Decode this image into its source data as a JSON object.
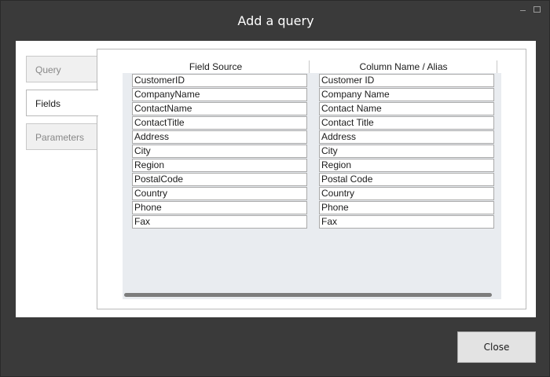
{
  "window": {
    "title": "Add a query"
  },
  "tabs": [
    {
      "label": "Query",
      "active": false
    },
    {
      "label": "Fields",
      "active": true
    },
    {
      "label": "Parameters",
      "active": false
    }
  ],
  "grid": {
    "columns": [
      "Field Source",
      "Column Name / Alias"
    ],
    "rows": [
      {
        "source": "CustomerID",
        "alias": "Customer ID"
      },
      {
        "source": "CompanyName",
        "alias": "Company Name"
      },
      {
        "source": "ContactName",
        "alias": "Contact Name"
      },
      {
        "source": "ContactTitle",
        "alias": "Contact Title"
      },
      {
        "source": "Address",
        "alias": "Address"
      },
      {
        "source": "City",
        "alias": "City"
      },
      {
        "source": "Region",
        "alias": "Region"
      },
      {
        "source": "PostalCode",
        "alias": "Postal Code"
      },
      {
        "source": "Country",
        "alias": "Country"
      },
      {
        "source": "Phone",
        "alias": "Phone"
      },
      {
        "source": "Fax",
        "alias": "Fax"
      }
    ]
  },
  "footer": {
    "close_label": "Close"
  },
  "colors": {
    "dialog_background": "#3a3a3a",
    "grid_background": "#e9ecf0"
  }
}
